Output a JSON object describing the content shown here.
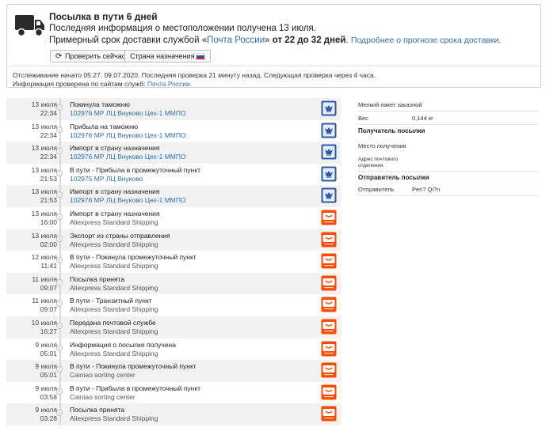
{
  "header": {
    "title": "Посылка в пути 6 дней",
    "line1": "Последняя информация о местоположении получена 13 июля.",
    "line2_prefix": "Примерный срок доставки службой «",
    "service_link": "Почта России",
    "line2_mid": "» ",
    "eta": "от 22 до 32 дней",
    "line2_end": ". ",
    "forecast_link": "Подробнее о прогнозе срока доставки.",
    "check_button": "Проверить сейчас",
    "country_button": "Страна назначения",
    "tracking_info": "Отслеживание начато 05:27, 09.07.2020. Последняя проверка 21 минуту назад. Следующая проверка через 4 часа.",
    "verified_prefix": "Информация проверена по сайтам служб: ",
    "verified_link": "Почта России",
    "verified_suffix": "."
  },
  "events": [
    {
      "date": "13 июля",
      "time": "22:34",
      "status": "Покинула таможню",
      "location": "102976 МР ЛЦ Внуково Цех-1 ММПО",
      "loc_style": "blue",
      "logo": "russian-post-icon"
    },
    {
      "date": "13 июля",
      "time": "22:34",
      "status": "Прибыла на таможню",
      "location": "102976 МР ЛЦ Внуково Цех-1 ММПО",
      "loc_style": "blue",
      "logo": "russian-post-icon"
    },
    {
      "date": "13 июля",
      "time": "22:34",
      "status": "Импорт в страну назначения",
      "location": "102976 МР ЛЦ Внуково Цех-1 ММПО",
      "loc_style": "blue",
      "logo": "russian-post-icon"
    },
    {
      "date": "13 июля",
      "time": "21:53",
      "status": "В пути - Прибыла в промежуточный пункт",
      "location": "102975 МР ЛЦ Внуково",
      "loc_style": "blue",
      "logo": "russian-post-icon"
    },
    {
      "date": "13 июля",
      "time": "21:53",
      "status": "Импорт в страну назначения",
      "location": "102976 МР ЛЦ Внуково Цех-1 ММПО",
      "loc_style": "blue",
      "logo": "russian-post-icon"
    },
    {
      "date": "13 июля",
      "time": "16:00",
      "status": "Импорт в страну назначения",
      "location": "Aliexpress Standard Shipping",
      "loc_style": "grey",
      "logo": "aliexpress-icon"
    },
    {
      "date": "13 июля",
      "time": "02:00",
      "status": "Экспорт из страны отправления",
      "location": "Aliexpress Standard Shipping",
      "loc_style": "grey",
      "logo": "aliexpress-icon"
    },
    {
      "date": "12 июля",
      "time": "11:41",
      "status": "В пути - Покинула промежуточный пункт",
      "location": "Aliexpress Standard Shipping",
      "loc_style": "grey",
      "logo": "aliexpress-icon"
    },
    {
      "date": "11 июля",
      "time": "09:07",
      "status": "Посылка принята",
      "location": "Aliexpress Standard Shipping",
      "loc_style": "grey",
      "logo": "aliexpress-icon"
    },
    {
      "date": "11 июля",
      "time": "09:07",
      "status": "В пути - Транзитный пункт",
      "location": "Aliexpress Standard Shipping",
      "loc_style": "grey",
      "logo": "aliexpress-icon"
    },
    {
      "date": "10 июля",
      "time": "16:27",
      "status": "Передана почтовой службе",
      "location": "Aliexpress Standard Shipping",
      "loc_style": "grey",
      "logo": "aliexpress-icon"
    },
    {
      "date": "9 июля",
      "time": "05:01",
      "status": "Информация о посылке получена",
      "location": "Aliexpress Standard Shipping",
      "loc_style": "grey",
      "logo": "aliexpress-icon"
    },
    {
      "date": "9 июля",
      "time": "05:01",
      "status": "В пути - Покинула промежуточный пункт",
      "location": "Cainiao sorting center",
      "loc_style": "grey",
      "logo": "aliexpress-icon"
    },
    {
      "date": "9 июля",
      "time": "03:58",
      "status": "В пути - Прибыла в промежуточный пункт",
      "location": "Cainiao sorting center",
      "loc_style": "grey",
      "logo": "aliexpress-icon"
    },
    {
      "date": "9 июля",
      "time": "03:28",
      "status": "Посылка принята",
      "location": "Aliexpress Standard Shipping",
      "loc_style": "grey",
      "logo": "aliexpress-icon"
    }
  ],
  "details": {
    "package_type": "Мелкий пакет заказной",
    "weight_label": "Вес",
    "weight_value": "0,144 кг",
    "recipient_header": "Получатель посылки",
    "destination_label": "Место получения",
    "postal_label_1": "Адрес почтового",
    "postal_label_2": "отделения",
    "sender_header": "Отправитель посылки",
    "sender_label": "Отправитель",
    "sender_value": "Pen? Qi?n"
  },
  "colors": {
    "accent": "#2a6fb0",
    "russian_post": "#2e5aa8",
    "aliexpress": "#ff4a00",
    "row_shade": "#f2f2f2"
  }
}
